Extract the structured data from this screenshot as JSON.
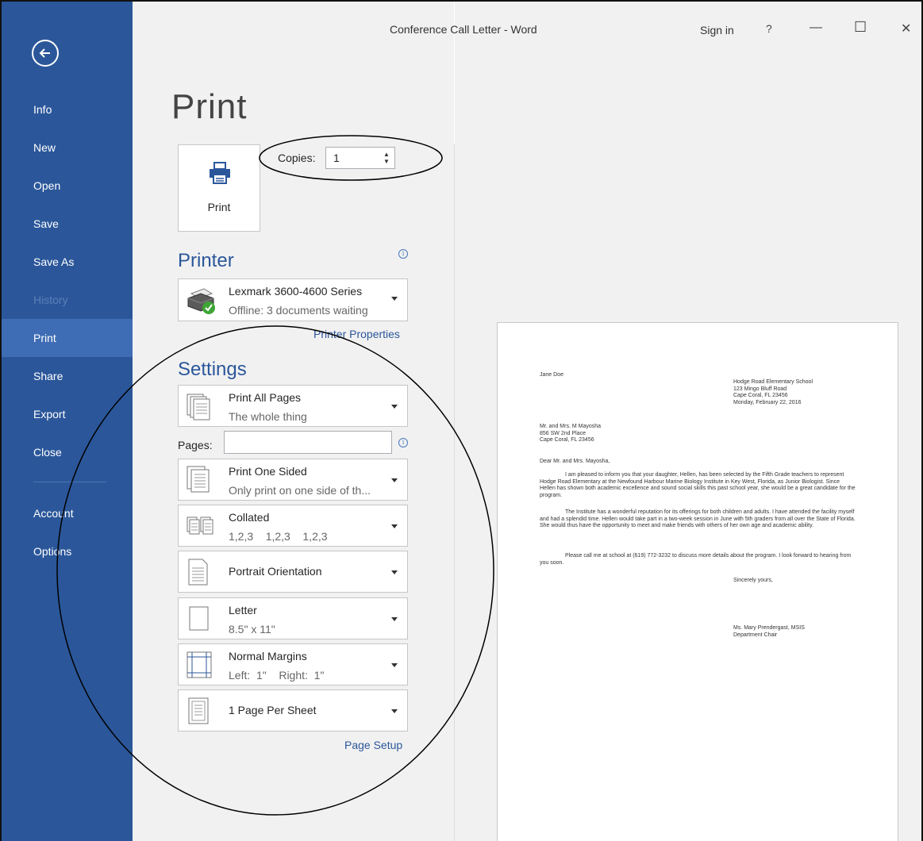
{
  "window": {
    "title": "Conference Call Letter - Word",
    "sign_in": "Sign in",
    "help": "?",
    "minimize": "—",
    "maximize": "☐",
    "close": "✕"
  },
  "nav": {
    "items": [
      {
        "label": "Info"
      },
      {
        "label": "New"
      },
      {
        "label": "Open"
      },
      {
        "label": "Save"
      },
      {
        "label": "Save As"
      },
      {
        "label": "History"
      },
      {
        "label": "Print"
      },
      {
        "label": "Share"
      },
      {
        "label": "Export"
      },
      {
        "label": "Close"
      },
      {
        "label": "Account"
      },
      {
        "label": "Options"
      }
    ],
    "active": "Print",
    "disabled": "History",
    "accent_color": "#2b579a"
  },
  "print": {
    "page_title": "Print",
    "button_label": "Print",
    "copies_label": "Copies:",
    "copies_value": "1"
  },
  "printer": {
    "heading": "Printer",
    "name": "Lexmark 3600-4600 Series",
    "status": "Offline: 3 documents waiting",
    "properties_link": "Printer Properties"
  },
  "settings": {
    "heading": "Settings",
    "pages_label": "Pages:",
    "pages_value": "",
    "items": [
      {
        "title": "Print All Pages",
        "subtitle": "The whole thing",
        "icon": "pages-icon"
      },
      {
        "title": "Print One Sided",
        "subtitle": "Only print on one side of th...",
        "icon": "one-sided-icon"
      },
      {
        "title": "Collated",
        "subtitle": "1,2,3    1,2,3    1,2,3",
        "icon": "collated-icon"
      },
      {
        "title": "Portrait Orientation",
        "subtitle": "",
        "icon": "portrait-icon"
      },
      {
        "title": "Letter",
        "subtitle": "8.5\" x 11\"",
        "icon": "letter-icon"
      },
      {
        "title": "Normal Margins",
        "subtitle": "Left:  1\"    Right:  1\"",
        "icon": "margins-icon"
      },
      {
        "title": "1 Page Per Sheet",
        "subtitle": "",
        "icon": "per-sheet-icon"
      }
    ],
    "page_setup_link": "Page Setup"
  },
  "preview": {
    "sender": "Jane Doe",
    "school_lines": [
      "Hodge Road Elementary School",
      "123 Mingo Bluff Road",
      "Cape Coral, FL 23456",
      "Monday, February 22, 2016"
    ],
    "recipient_lines": [
      "Mr. and Mrs. M Mayosha",
      "856 SW 2nd Place",
      "Cape Coral, FL 23456"
    ],
    "salutation": "Dear Mr. and Mrs. Mayosha,",
    "para1": "I am pleased to inform you that your daughter, Hellen, has been selected by the Fifth Grade teachers to represent Hodge Road Elementary at the Newfound Harbour Marine Biology Institute in Key West, Florida, as Junior Biologist.  Since Hellen has shown both academic excellence and sound social skills this past school year, she would be a great candidate for the program.",
    "para2": "The Institute has a wonderful reputation for its offerings for both children and adults.  I have attended the facility myself and had a splendid time.  Hellen would take part in a two-week session in June with 5th graders from all over the State of Florida.  She would thus have the opportunity to meet and make friends with others of her own age and academic ability.",
    "para3": "Please call me at school at (619) 772-3232 to discuss more details about the program.  I look forward to hearing from you soon.",
    "closing": "Sincerely yours,",
    "signature_lines": [
      "Ms. Mary Prendergast, MSIS",
      "Department Chair"
    ]
  }
}
